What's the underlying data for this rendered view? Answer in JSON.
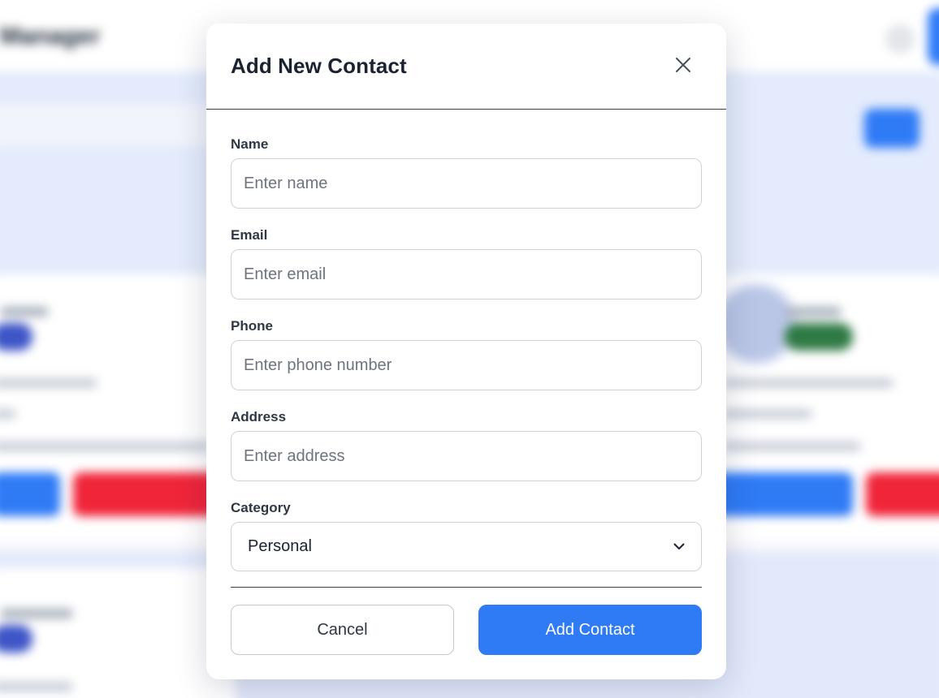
{
  "background": {
    "app_title": "Manager"
  },
  "modal": {
    "title": "Add New Contact",
    "close_icon": "close-icon",
    "fields": {
      "name": {
        "label": "Name",
        "placeholder": "Enter name",
        "value": ""
      },
      "email": {
        "label": "Email",
        "placeholder": "Enter email",
        "value": ""
      },
      "phone": {
        "label": "Phone",
        "placeholder": "Enter phone number",
        "value": ""
      },
      "address": {
        "label": "Address",
        "placeholder": "Enter address",
        "value": ""
      },
      "category": {
        "label": "Category",
        "selected": "Personal",
        "icon": "chevron-down-icon"
      }
    },
    "buttons": {
      "cancel": "Cancel",
      "add": "Add Contact"
    }
  },
  "colors": {
    "primary": "#2f7bf6",
    "danger": "#f0253a",
    "success": "#2f7a45",
    "text_dark": "#1b2230",
    "border": "#cfd3d9"
  }
}
